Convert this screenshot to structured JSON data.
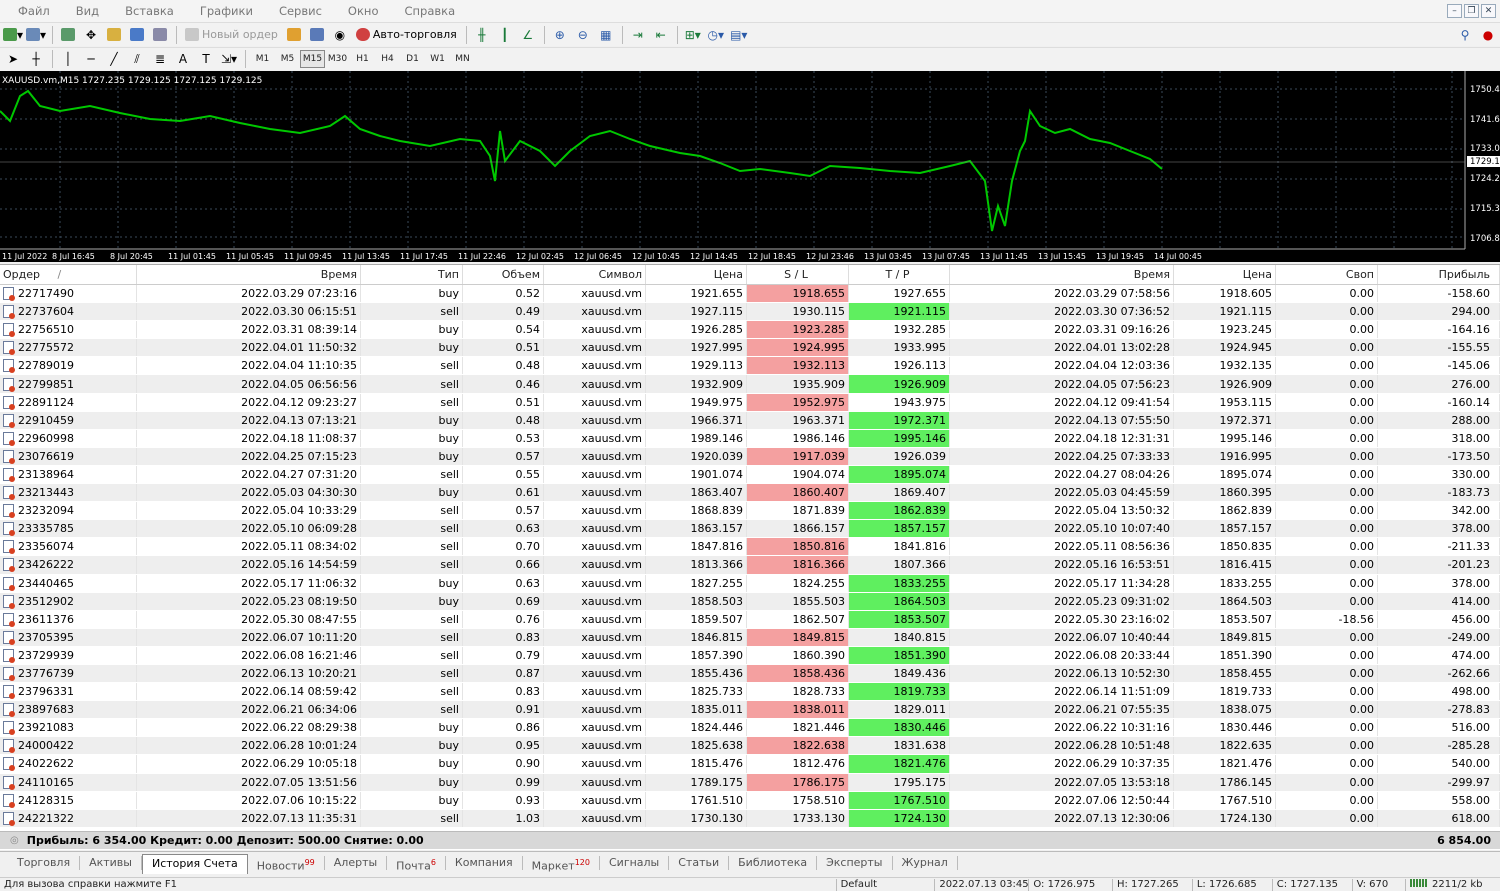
{
  "menu": [
    "Файл",
    "Вид",
    "Вставка",
    "Графики",
    "Сервис",
    "Окно",
    "Справка"
  ],
  "toolbar": {
    "new_order": "Новый ордер",
    "auto_trading": "Авто-торговля"
  },
  "timeframes": [
    "M1",
    "M5",
    "M15",
    "M30",
    "H1",
    "H4",
    "D1",
    "W1",
    "MN"
  ],
  "active_timeframe": "M15",
  "chart": {
    "header": "XAUUSD.vm,M15  1727.235 1729.125 1727.125 1729.125",
    "price_labels": [
      "1750.48",
      "1741.61",
      "1733.06",
      "1729.12",
      "1724.21",
      "1715.38",
      "1706.80"
    ],
    "current_price": "1729.12",
    "time_labels": [
      "11 Jul 2022",
      "8 Jul 16:45",
      "8 Jul 20:45",
      "11 Jul 01:45",
      "11 Jul 05:45",
      "11 Jul 09:45",
      "11 Jul 13:45",
      "11 Jul 17:45",
      "11 Jul 22:46",
      "12 Jul 02:45",
      "12 Jul 06:45",
      "12 Jul 10:45",
      "12 Jul 14:45",
      "12 Jul 18:45",
      "12 Jul 23:46",
      "13 Jul 03:45",
      "13 Jul 07:45",
      "13 Jul 11:45",
      "13 Jul 15:45",
      "13 Jul 19:45",
      "14 Jul 00:45"
    ],
    "line_color": "#00c800",
    "bg_color": "#000000"
  },
  "columns": {
    "order": "Ордер",
    "sort": "/",
    "time": "Время",
    "type": "Тип",
    "volume": "Объем",
    "symbol": "Символ",
    "price": "Цена",
    "sl": "S / L",
    "tp": "T / P",
    "close_time": "Время",
    "close_price": "Цена",
    "swap": "Своп",
    "profit": "Прибыль"
  },
  "rows": [
    [
      "22717490",
      "2022.03.29 07:23:16",
      "buy",
      "0.52",
      "xauusd.vm",
      "1921.655",
      "1918.655",
      "1927.655",
      "2022.03.29 07:58:56",
      "1918.605",
      "0.00",
      "-158.60",
      "sl"
    ],
    [
      "22737604",
      "2022.03.30 06:15:51",
      "sell",
      "0.49",
      "xauusd.vm",
      "1927.115",
      "1930.115",
      "1921.115",
      "2022.03.30 07:36:52",
      "1921.115",
      "0.00",
      "294.00",
      "tp"
    ],
    [
      "22756510",
      "2022.03.31 08:39:14",
      "buy",
      "0.54",
      "xauusd.vm",
      "1926.285",
      "1923.285",
      "1932.285",
      "2022.03.31 09:16:26",
      "1923.245",
      "0.00",
      "-164.16",
      "sl"
    ],
    [
      "22775572",
      "2022.04.01 11:50:32",
      "buy",
      "0.51",
      "xauusd.vm",
      "1927.995",
      "1924.995",
      "1933.995",
      "2022.04.01 13:02:28",
      "1924.945",
      "0.00",
      "-155.55",
      "sl"
    ],
    [
      "22789019",
      "2022.04.04 11:10:35",
      "sell",
      "0.48",
      "xauusd.vm",
      "1929.113",
      "1932.113",
      "1926.113",
      "2022.04.04 12:03:36",
      "1932.135",
      "0.00",
      "-145.06",
      "sl"
    ],
    [
      "22799851",
      "2022.04.05 06:56:56",
      "sell",
      "0.46",
      "xauusd.vm",
      "1932.909",
      "1935.909",
      "1926.909",
      "2022.04.05 07:56:23",
      "1926.909",
      "0.00",
      "276.00",
      "tp"
    ],
    [
      "22891124",
      "2022.04.12 09:23:27",
      "sell",
      "0.51",
      "xauusd.vm",
      "1949.975",
      "1952.975",
      "1943.975",
      "2022.04.12 09:41:54",
      "1953.115",
      "0.00",
      "-160.14",
      "sl"
    ],
    [
      "22910459",
      "2022.04.13 07:13:21",
      "buy",
      "0.48",
      "xauusd.vm",
      "1966.371",
      "1963.371",
      "1972.371",
      "2022.04.13 07:55:50",
      "1972.371",
      "0.00",
      "288.00",
      "tp"
    ],
    [
      "22960998",
      "2022.04.18 11:08:37",
      "buy",
      "0.53",
      "xauusd.vm",
      "1989.146",
      "1986.146",
      "1995.146",
      "2022.04.18 12:31:31",
      "1995.146",
      "0.00",
      "318.00",
      "tp"
    ],
    [
      "23076619",
      "2022.04.25 07:15:23",
      "buy",
      "0.57",
      "xauusd.vm",
      "1920.039",
      "1917.039",
      "1926.039",
      "2022.04.25 07:33:33",
      "1916.995",
      "0.00",
      "-173.50",
      "sl"
    ],
    [
      "23138964",
      "2022.04.27 07:31:20",
      "sell",
      "0.55",
      "xauusd.vm",
      "1901.074",
      "1904.074",
      "1895.074",
      "2022.04.27 08:04:26",
      "1895.074",
      "0.00",
      "330.00",
      "tp"
    ],
    [
      "23213443",
      "2022.05.03 04:30:30",
      "buy",
      "0.61",
      "xauusd.vm",
      "1863.407",
      "1860.407",
      "1869.407",
      "2022.05.03 04:45:59",
      "1860.395",
      "0.00",
      "-183.73",
      "sl"
    ],
    [
      "23232094",
      "2022.05.04 10:33:29",
      "sell",
      "0.57",
      "xauusd.vm",
      "1868.839",
      "1871.839",
      "1862.839",
      "2022.05.04 13:50:32",
      "1862.839",
      "0.00",
      "342.00",
      "tp"
    ],
    [
      "23335785",
      "2022.05.10 06:09:28",
      "sell",
      "0.63",
      "xauusd.vm",
      "1863.157",
      "1866.157",
      "1857.157",
      "2022.05.10 10:07:40",
      "1857.157",
      "0.00",
      "378.00",
      "tp"
    ],
    [
      "23356074",
      "2022.05.11 08:34:02",
      "sell",
      "0.70",
      "xauusd.vm",
      "1847.816",
      "1850.816",
      "1841.816",
      "2022.05.11 08:56:36",
      "1850.835",
      "0.00",
      "-211.33",
      "sl"
    ],
    [
      "23426222",
      "2022.05.16 14:54:59",
      "sell",
      "0.66",
      "xauusd.vm",
      "1813.366",
      "1816.366",
      "1807.366",
      "2022.05.16 16:53:51",
      "1816.415",
      "0.00",
      "-201.23",
      "sl"
    ],
    [
      "23440465",
      "2022.05.17 11:06:32",
      "buy",
      "0.63",
      "xauusd.vm",
      "1827.255",
      "1824.255",
      "1833.255",
      "2022.05.17 11:34:28",
      "1833.255",
      "0.00",
      "378.00",
      "tp"
    ],
    [
      "23512902",
      "2022.05.23 08:19:50",
      "buy",
      "0.69",
      "xauusd.vm",
      "1858.503",
      "1855.503",
      "1864.503",
      "2022.05.23 09:31:02",
      "1864.503",
      "0.00",
      "414.00",
      "tp"
    ],
    [
      "23611376",
      "2022.05.30 08:47:55",
      "sell",
      "0.76",
      "xauusd.vm",
      "1859.507",
      "1862.507",
      "1853.507",
      "2022.05.30 23:16:02",
      "1853.507",
      "-18.56",
      "456.00",
      "tp"
    ],
    [
      "23705395",
      "2022.06.07 10:11:20",
      "sell",
      "0.83",
      "xauusd.vm",
      "1846.815",
      "1849.815",
      "1840.815",
      "2022.06.07 10:40:44",
      "1849.815",
      "0.00",
      "-249.00",
      "sl"
    ],
    [
      "23729939",
      "2022.06.08 16:21:46",
      "sell",
      "0.79",
      "xauusd.vm",
      "1857.390",
      "1860.390",
      "1851.390",
      "2022.06.08 20:33:44",
      "1851.390",
      "0.00",
      "474.00",
      "tp"
    ],
    [
      "23776739",
      "2022.06.13 10:20:21",
      "sell",
      "0.87",
      "xauusd.vm",
      "1855.436",
      "1858.436",
      "1849.436",
      "2022.06.13 10:52:30",
      "1858.455",
      "0.00",
      "-262.66",
      "sl"
    ],
    [
      "23796331",
      "2022.06.14 08:59:42",
      "sell",
      "0.83",
      "xauusd.vm",
      "1825.733",
      "1828.733",
      "1819.733",
      "2022.06.14 11:51:09",
      "1819.733",
      "0.00",
      "498.00",
      "tp"
    ],
    [
      "23897683",
      "2022.06.21 06:34:06",
      "sell",
      "0.91",
      "xauusd.vm",
      "1835.011",
      "1838.011",
      "1829.011",
      "2022.06.21 07:55:35",
      "1838.075",
      "0.00",
      "-278.83",
      "sl"
    ],
    [
      "23921083",
      "2022.06.22 08:29:38",
      "buy",
      "0.86",
      "xauusd.vm",
      "1824.446",
      "1821.446",
      "1830.446",
      "2022.06.22 10:31:16",
      "1830.446",
      "0.00",
      "516.00",
      "tp"
    ],
    [
      "24000422",
      "2022.06.28 10:01:24",
      "buy",
      "0.95",
      "xauusd.vm",
      "1825.638",
      "1822.638",
      "1831.638",
      "2022.06.28 10:51:48",
      "1822.635",
      "0.00",
      "-285.28",
      "sl"
    ],
    [
      "24022622",
      "2022.06.29 10:05:18",
      "buy",
      "0.90",
      "xauusd.vm",
      "1815.476",
      "1812.476",
      "1821.476",
      "2022.06.29 10:37:35",
      "1821.476",
      "0.00",
      "540.00",
      "tp"
    ],
    [
      "24110165",
      "2022.07.05 13:51:56",
      "buy",
      "0.99",
      "xauusd.vm",
      "1789.175",
      "1786.175",
      "1795.175",
      "2022.07.05 13:53:18",
      "1786.145",
      "0.00",
      "-299.97",
      "sl"
    ],
    [
      "24128315",
      "2022.07.06 10:15:22",
      "buy",
      "0.93",
      "xauusd.vm",
      "1761.510",
      "1758.510",
      "1767.510",
      "2022.07.06 12:50:44",
      "1767.510",
      "0.00",
      "558.00",
      "tp"
    ],
    [
      "24221322",
      "2022.07.13 11:35:31",
      "sell",
      "1.03",
      "xauusd.vm",
      "1730.130",
      "1733.130",
      "1724.130",
      "2022.07.13 12:30:06",
      "1724.130",
      "0.00",
      "618.00",
      "tp"
    ]
  ],
  "summary": {
    "text": "Прибыль: 6 354.00  Кредит: 0.00  Депозит: 500.00  Снятие: 0.00",
    "total": "6 854.00"
  },
  "tabs": [
    {
      "label": "Торговля",
      "badge": ""
    },
    {
      "label": "Активы",
      "badge": ""
    },
    {
      "label": "История Счета",
      "badge": "",
      "active": true
    },
    {
      "label": "Новости",
      "badge": "99"
    },
    {
      "label": "Алерты",
      "badge": ""
    },
    {
      "label": "Почта",
      "badge": "6"
    },
    {
      "label": "Компания",
      "badge": ""
    },
    {
      "label": "Маркет",
      "badge": "120"
    },
    {
      "label": "Сигналы",
      "badge": ""
    },
    {
      "label": "Статьи",
      "badge": ""
    },
    {
      "label": "Библиотека",
      "badge": ""
    },
    {
      "label": "Эксперты",
      "badge": ""
    },
    {
      "label": "Журнал",
      "badge": ""
    }
  ],
  "status": {
    "help": "Для вызова справки нажмите F1",
    "profile": "Default",
    "datetime": "2022.07.13 03:45",
    "open": "O: 1726.975",
    "high": "H: 1727.265",
    "low": "L: 1726.685",
    "close": "C: 1727.135",
    "volume": "V: 670",
    "traffic": "2211/2 kb"
  },
  "colors": {
    "sl_hit": "#f4a0a0",
    "tp_hit": "#5fef5f"
  }
}
